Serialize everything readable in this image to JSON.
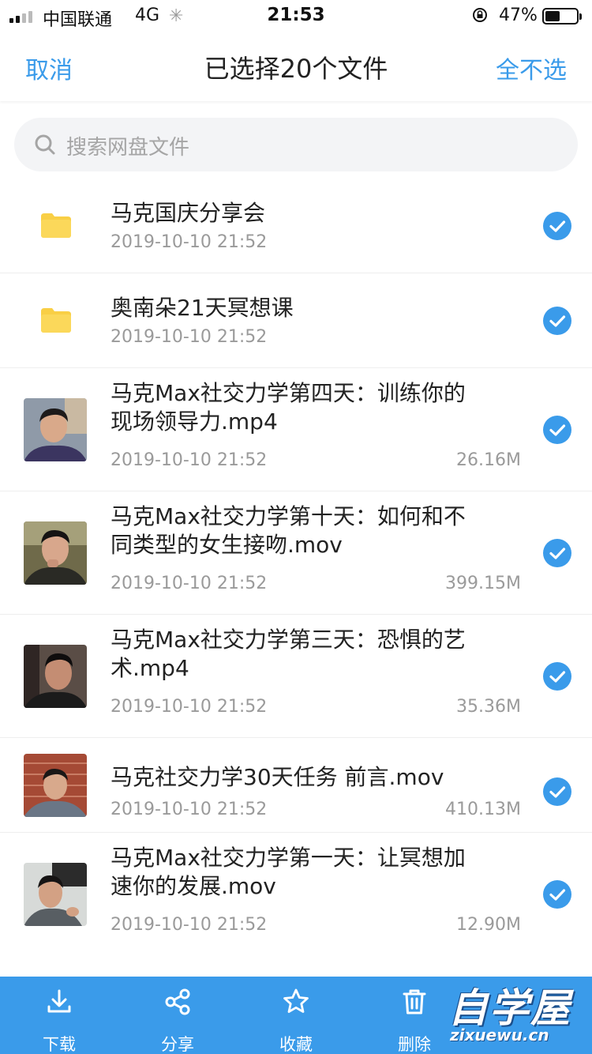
{
  "status_bar": {
    "carrier": "中国联通",
    "network": "4G",
    "time": "21:53",
    "battery_percent": "47%",
    "battery_level": 0.47,
    "signal_bars": 2
  },
  "nav": {
    "cancel_label": "取消",
    "title": "已选择20个文件",
    "deselect_all_label": "全不选"
  },
  "search": {
    "placeholder": "搜索网盘文件"
  },
  "files": [
    {
      "type": "folder",
      "name": "马克国庆分享会",
      "date": "2019-10-10 21:52",
      "size": "",
      "selected": true
    },
    {
      "type": "folder",
      "name": "奥南朵21天冥想课",
      "date": "2019-10-10 21:52",
      "size": "",
      "selected": true
    },
    {
      "type": "video",
      "name": "马克Max社交力学第四天：训练你的现场领导力.mp4",
      "date": "2019-10-10 21:52",
      "size": "26.16M",
      "selected": true
    },
    {
      "type": "video",
      "name": "马克Max社交力学第十天：如何和不同类型的女生接吻.mov",
      "date": "2019-10-10 21:52",
      "size": "399.15M",
      "selected": true
    },
    {
      "type": "video",
      "name": "马克Max社交力学第三天：恐惧的艺术.mp4",
      "date": "2019-10-10 21:52",
      "size": "35.36M",
      "selected": true
    },
    {
      "type": "video",
      "name": "马克社交力学30天任务 前言.mov",
      "date": "2019-10-10 21:52",
      "size": "410.13M",
      "selected": true
    },
    {
      "type": "video",
      "name": "马克Max社交力学第一天：让冥想加速你的发展.mov",
      "date": "2019-10-10 21:52",
      "size": "12.90M",
      "selected": true
    }
  ],
  "toolbar": {
    "download_label": "下载",
    "share_label": "分享",
    "favorite_label": "收藏",
    "delete_label": "删除"
  },
  "watermark": {
    "title": "自学屋",
    "url": "zixuewu.cn"
  },
  "colors": {
    "accent": "#3a9bea",
    "folder": "#f9cf45",
    "check": "#3a9bea"
  }
}
